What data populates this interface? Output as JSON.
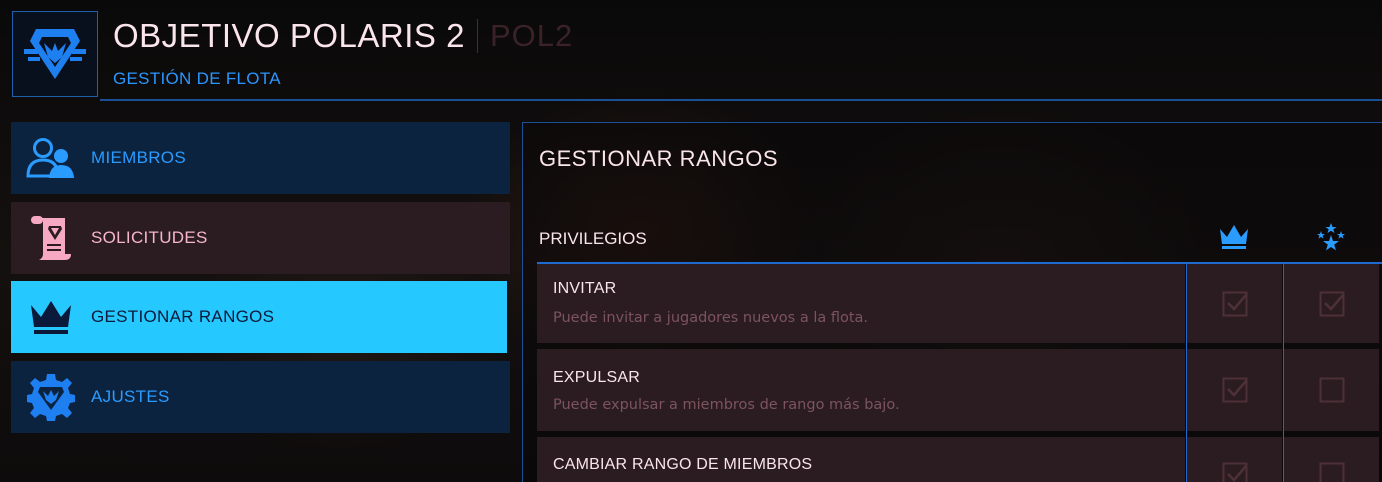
{
  "header": {
    "title": "OBJETIVO POLARIS 2",
    "tag": "POL2",
    "subtitle": "GESTIÓN DE FLOTA",
    "emblem_icon": "fleet-emblem-icon"
  },
  "sidebar": {
    "items": [
      {
        "label": "MIEMBROS",
        "icon": "members-icon",
        "state": "default"
      },
      {
        "label": "SOLICITUDES",
        "icon": "scroll-icon",
        "state": "highlight"
      },
      {
        "label": "GESTIONAR RANGOS",
        "icon": "crown-icon",
        "state": "active"
      },
      {
        "label": "AJUSTES",
        "icon": "gear-icon",
        "state": "default"
      }
    ]
  },
  "main": {
    "title": "GESTIONAR RANGOS",
    "privileges_header": "PRIVILEGIOS",
    "columns": [
      {
        "icon": "crown-icon"
      },
      {
        "icon": "stars-icon"
      }
    ],
    "rows": [
      {
        "name": "INVITAR",
        "description": "Puede invitar a jugadores nuevos a la flota.",
        "values": [
          true,
          true
        ]
      },
      {
        "name": "EXPULSAR",
        "description": "Puede expulsar a miembros de rango más bajo.",
        "values": [
          true,
          false
        ]
      },
      {
        "name": "CAMBIAR RANGO DE MIEMBROS",
        "description": "",
        "values": [
          true,
          false
        ]
      }
    ]
  },
  "colors": {
    "accent_blue": "#2a9bff",
    "active_cyan": "#26c9ff",
    "pink_text": "#f7b6cc",
    "divider_blue": "#1e6ad0"
  }
}
